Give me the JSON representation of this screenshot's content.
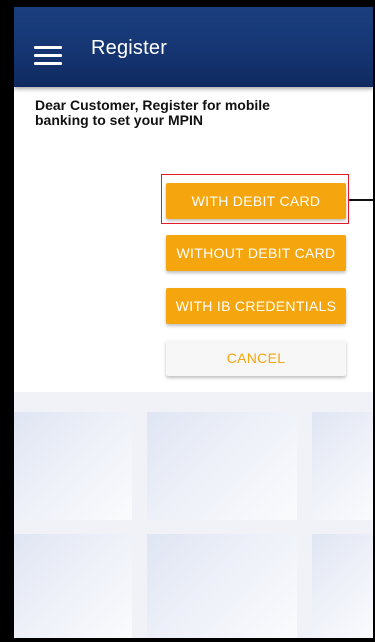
{
  "header": {
    "title": "Register",
    "menu_icon": "hamburger-menu-icon",
    "background": "#153572"
  },
  "message": "Dear Customer, Register for mobile banking to set your MPIN",
  "buttons": {
    "with_debit_card": "WITH DEBIT CARD",
    "without_debit_card": "WITHOUT DEBIT CARD",
    "with_ib_credentials": "WITH IB CREDENTIALS",
    "cancel": "CANCEL"
  },
  "colors": {
    "accent": "#f5a50d",
    "highlight_border": "#e21b2a",
    "cancel_background": "#f7f7f7"
  }
}
